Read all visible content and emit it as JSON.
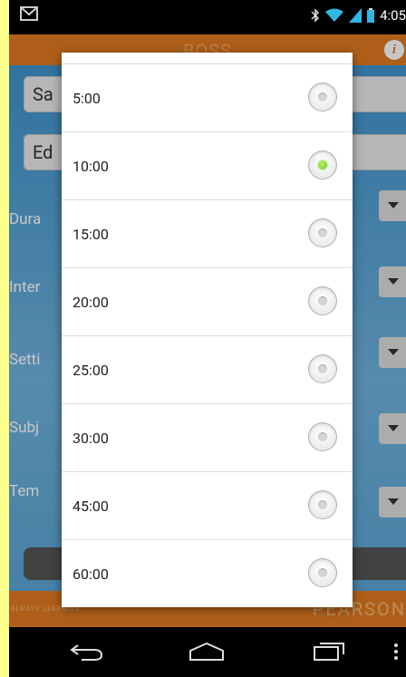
{
  "status_bar": {
    "time": "4:05"
  },
  "app_bar": {
    "title": "BOSS",
    "info_label": "i"
  },
  "background": {
    "field1_value": "Sa",
    "field2_value": "Ed",
    "labels": [
      "Dura",
      "Inter",
      "Setti",
      "Subj",
      "Tem"
    ]
  },
  "footer": {
    "left_text": "ALWAYS LEARNING",
    "right_text": "PEARSON"
  },
  "dialog": {
    "options": [
      {
        "label": "5:00",
        "selected": false
      },
      {
        "label": "10:00",
        "selected": true
      },
      {
        "label": "15:00",
        "selected": false
      },
      {
        "label": "20:00",
        "selected": false
      },
      {
        "label": "25:00",
        "selected": false
      },
      {
        "label": "30:00",
        "selected": false
      },
      {
        "label": "45:00",
        "selected": false
      },
      {
        "label": "60:00",
        "selected": false
      }
    ]
  },
  "colors": {
    "accent_orange": "#e07a22",
    "radio_selected": "#7ed321",
    "background_blue": "#3a8cc6",
    "outer_frame": "#ffff8c"
  }
}
